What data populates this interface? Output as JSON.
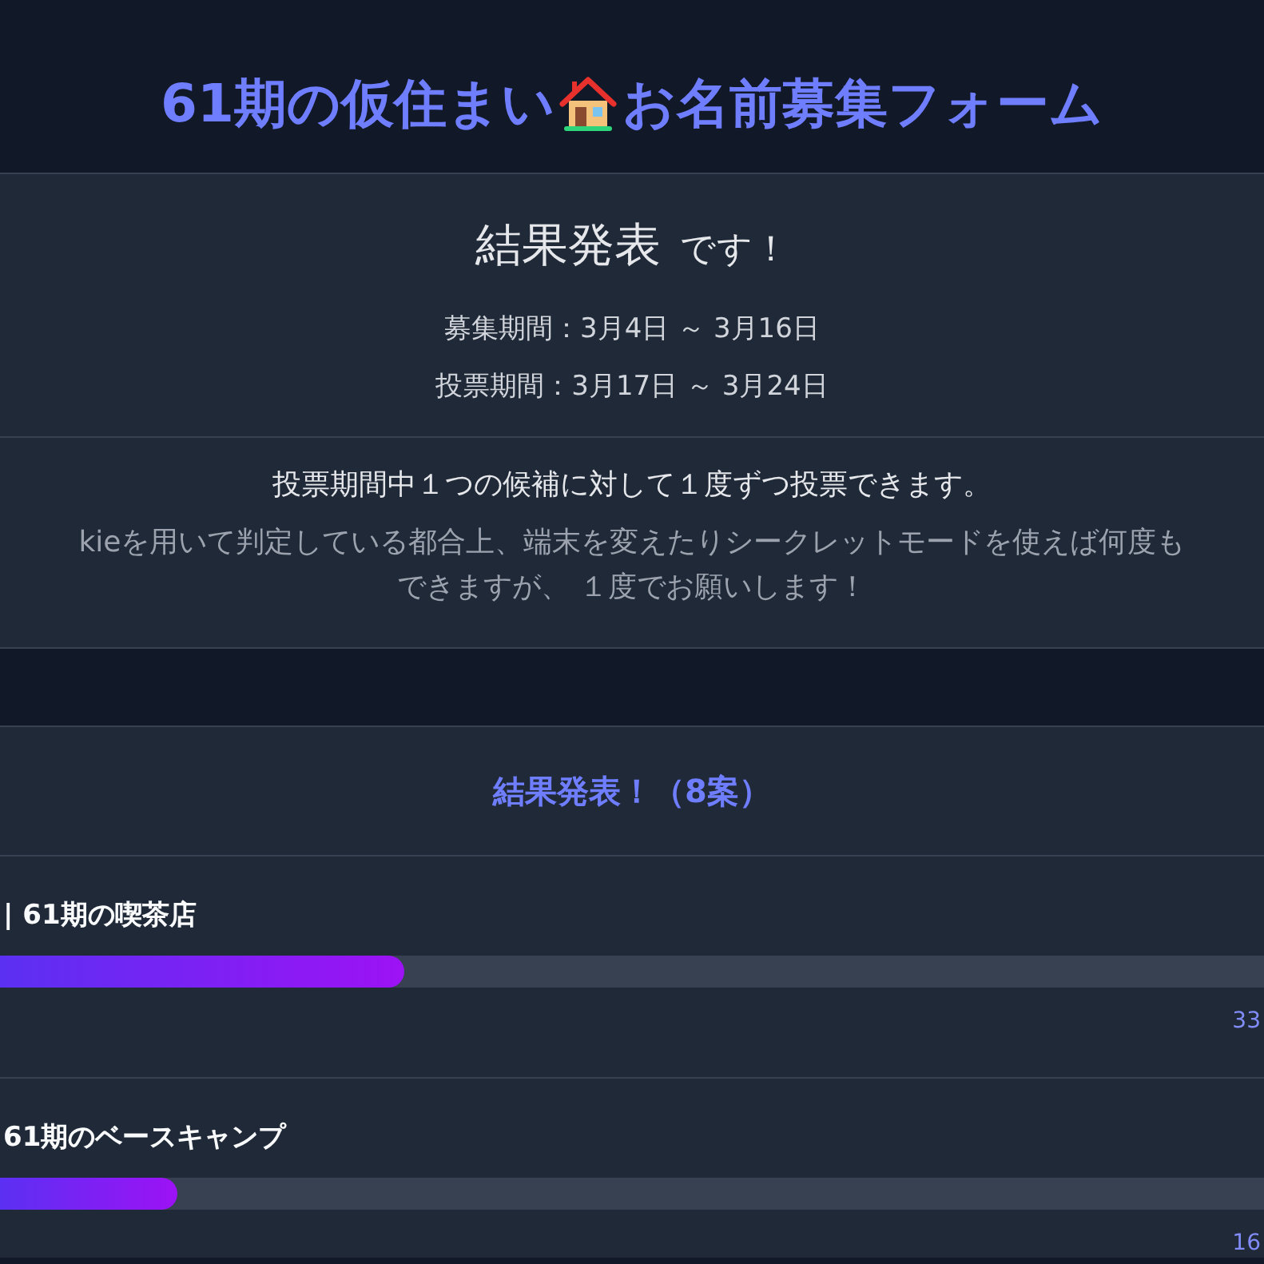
{
  "header": {
    "title_parts": [
      "61期の仮住まい",
      "お名前募集フォーム"
    ]
  },
  "announcement": {
    "heading": "結果発表",
    "heading_suffix": "です！",
    "periods": [
      "募集期間：3月4日 ～ 3月16日",
      "投票期間：3月17日 ～ 3月24日"
    ]
  },
  "notice": {
    "rule": "投票期間中１つの候補に対して１度ずつ投票できます。",
    "note_lines": [
      "kieを用いて判定している都合上、端末を変えたりシークレットモードを使えば何度も",
      "できますが、 １度でお願いします！"
    ]
  },
  "results": {
    "title": "結果発表！（8案）",
    "candidates": [
      {
        "name": "| 61期の喫茶店",
        "level": 0.32,
        "votes": "33"
      },
      {
        "name": "61期のベースキャンプ",
        "level": 0.14,
        "votes": "16"
      }
    ]
  }
}
